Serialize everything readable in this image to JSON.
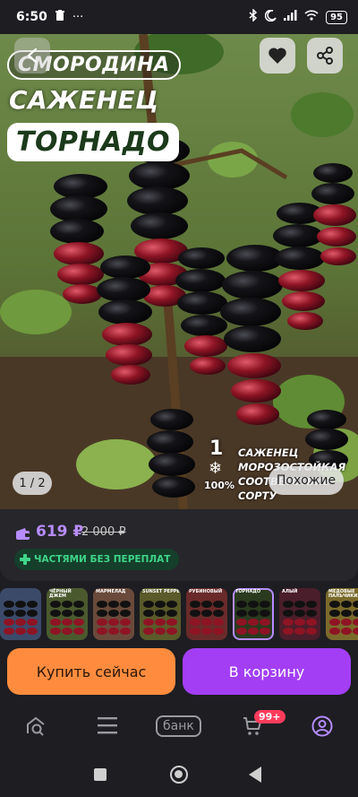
{
  "status_bar": {
    "time": "6:50",
    "battery": "95"
  },
  "hero": {
    "title_line1": "СМОРОДИНА",
    "title_line2": "САЖЕНЕЦ",
    "title_line3": "ТОРНАДО",
    "badge_number": "1",
    "badge_percent": "100%",
    "info_line1": "САЖЕНЕЦ",
    "info_line2": "МОРОЗОСТОЙКАЯ",
    "info_line3": "СООТВЕТСТВИЕ СОРТУ",
    "pager": "1 / 2",
    "similar_label": "Похожие"
  },
  "price": {
    "current": "619 ₽",
    "old": "2 000 ₽",
    "installment": "ЧАСТЯМИ БЕЗ ПЕРЕПЛАТ"
  },
  "thumbnails": [
    {
      "label": "",
      "color": "#3c4a6a",
      "selected": false
    },
    {
      "label": "ЧЁРНЫЙ ДЖЕМ",
      "color": "#4b5a2e",
      "selected": false
    },
    {
      "label": "МАРМЕЛАД",
      "color": "#6a4a3a",
      "selected": false
    },
    {
      "label": "SUNSET PEPPE",
      "color": "#5a5a2a",
      "selected": false
    },
    {
      "label": "РУБИНОВЫЙ",
      "color": "#6a2a2a",
      "selected": false
    },
    {
      "label": "ТОРНАДО",
      "color": "#2a3a1e",
      "selected": true
    },
    {
      "label": "АЛЫЙ",
      "color": "#4a1e2a",
      "selected": false
    },
    {
      "label": "МЕДОВЫЕ ПАЛЬЧИКИ",
      "color": "#7a6a2a",
      "selected": false
    }
  ],
  "actions": {
    "buy_now": "Купить сейчас",
    "to_cart": "В корзину"
  },
  "bottom_nav": {
    "bank": "банк",
    "cart_count": "99+"
  },
  "colors": {
    "accent": "#a33ef5",
    "price": "#b78cff",
    "buy_now": "#ff8c3e",
    "installment_text": "#3fd58a"
  }
}
